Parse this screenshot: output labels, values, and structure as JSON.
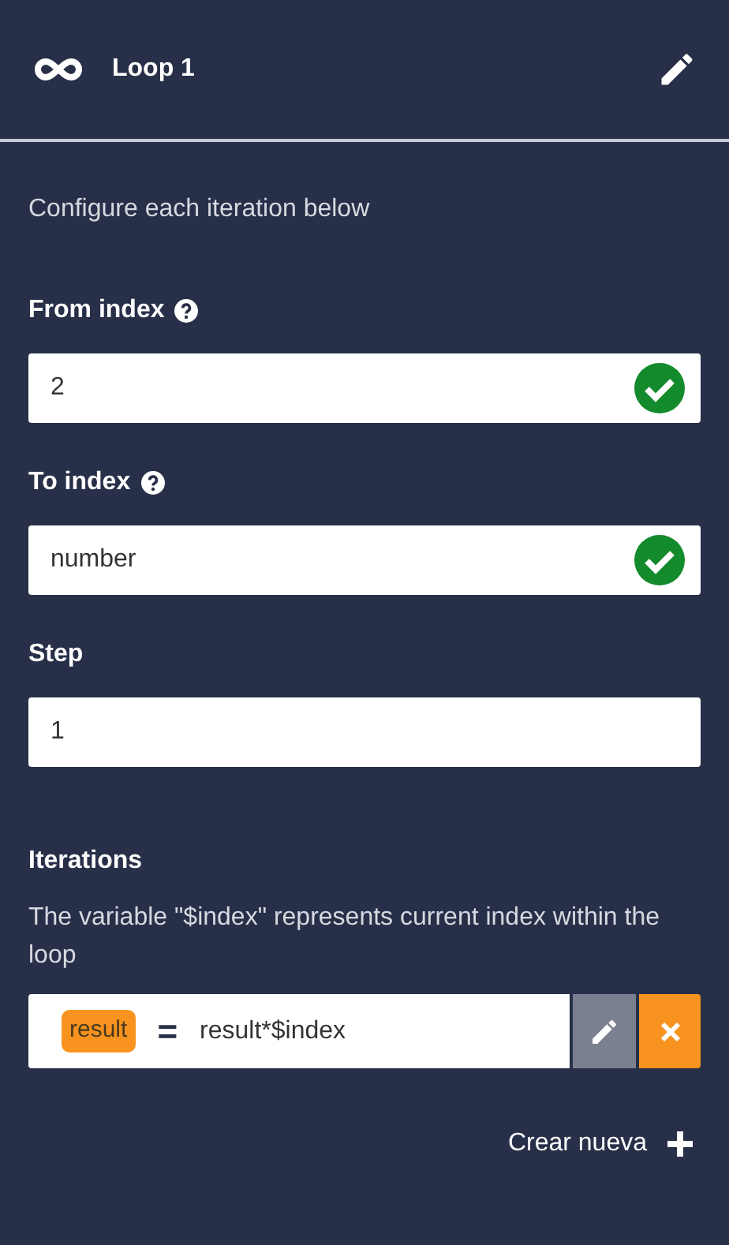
{
  "header": {
    "title": "Loop 1"
  },
  "intro": "Configure each iteration below",
  "fields": [
    {
      "label": "From index",
      "help": true,
      "value": "2",
      "valid": true
    },
    {
      "label": "To index",
      "help": true,
      "value": "number",
      "valid": true
    },
    {
      "label": "Step",
      "help": false,
      "value": "1",
      "valid": false
    }
  ],
  "iterations": {
    "title": "Iterations",
    "description": "The variable \"$index\" represents current index within the loop",
    "items": [
      {
        "variable": "result",
        "operator": "=",
        "expression": "result*$index"
      }
    ]
  },
  "add_button": {
    "label": "Crear nueva"
  }
}
